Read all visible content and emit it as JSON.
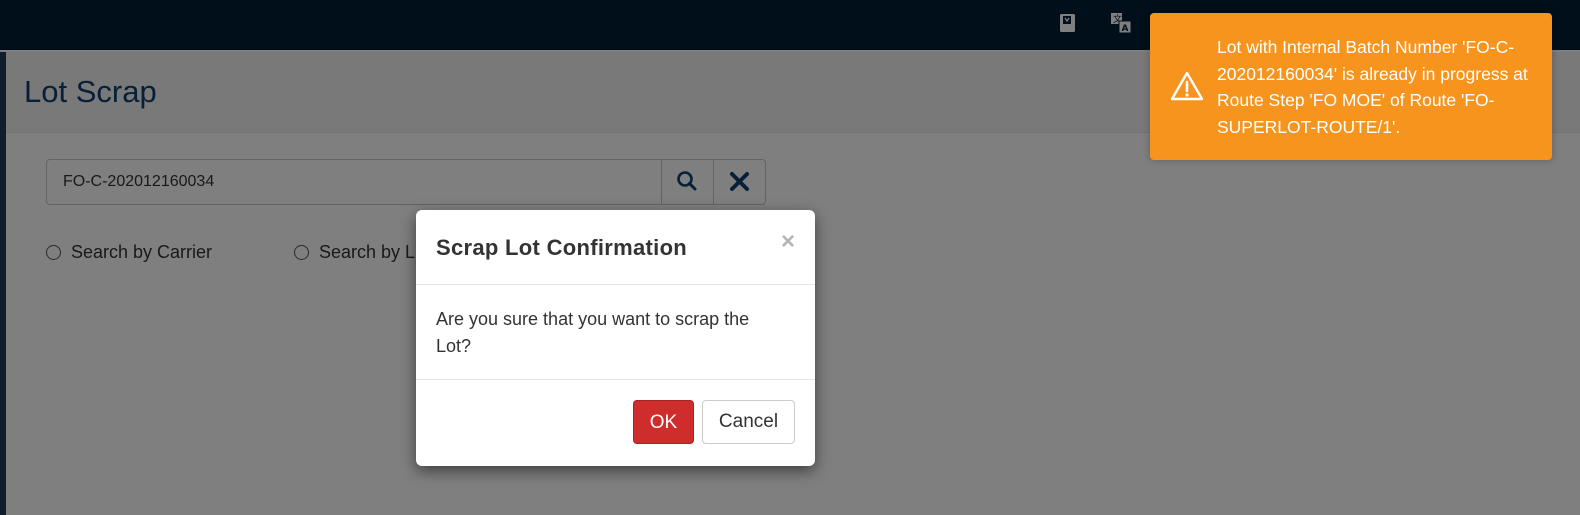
{
  "page": {
    "title": "Lot Scrap"
  },
  "topbar": {
    "icons": [
      "book-icon",
      "translate-icon"
    ]
  },
  "search": {
    "value": "FO-C-202012160034",
    "search_icon": "search-icon",
    "clear_icon": "close-icon"
  },
  "options": [
    {
      "label": "Search by Carrier"
    },
    {
      "label": "Search by L"
    }
  ],
  "modal": {
    "title": "Scrap Lot Confirmation",
    "close_symbol": "×",
    "body": "Are you sure that you want to scrap the Lot?",
    "ok_label": "OK",
    "cancel_label": "Cancel"
  },
  "toast": {
    "icon": "warning-icon",
    "message": "Lot with Internal Batch Number 'FO-C-202012160034' is already in progress at Route Step 'FO MOE' of Route 'FO-SUPERLOT-ROUTE/1'.",
    "color": "#f7941d"
  },
  "colors": {
    "topbar": "#021e36",
    "title": "#0f3f6f",
    "ok_button": "#cf2d2b"
  }
}
